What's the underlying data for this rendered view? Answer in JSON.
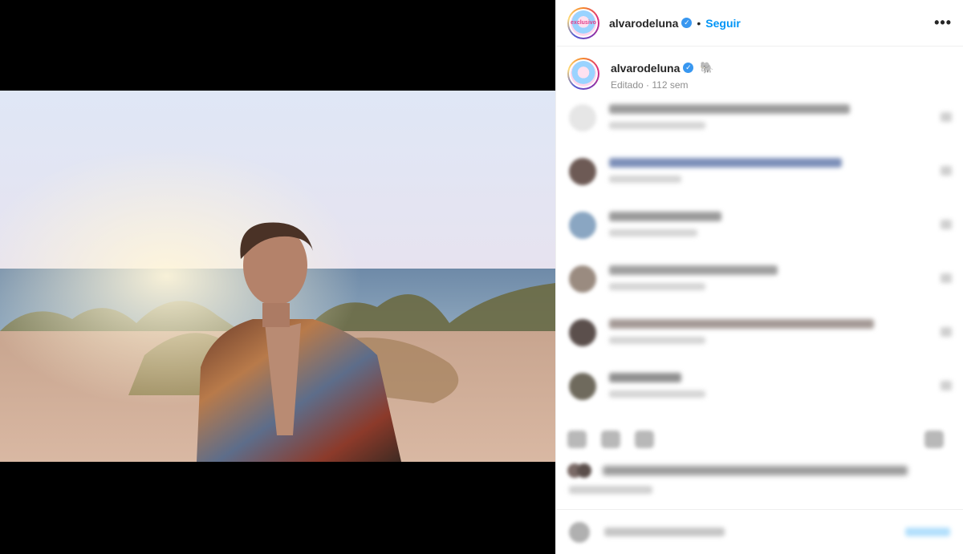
{
  "post": {
    "username": "alvarodeluna",
    "follow_label": "Seguir",
    "separator": "•",
    "more_label": "•••",
    "avatar_text": "exclusivo",
    "caption_emoji": "🐘",
    "edited_text": "Editado · 112 sem"
  },
  "comments": [
    {
      "avatar_color": "#e6e6e6",
      "line_width": 300,
      "line_color": "#9c9c9c",
      "sub_width": 120
    },
    {
      "avatar_color": "#6d5a55",
      "line_width": 290,
      "line_color": "#7c8fb8",
      "sub_width": 90
    },
    {
      "avatar_color": "#8aa6c2",
      "line_width": 140,
      "line_color": "#9a9a9a",
      "sub_width": 110
    },
    {
      "avatar_color": "#9a8b80",
      "line_width": 210,
      "line_color": "#a0a0a0",
      "sub_width": 120
    },
    {
      "avatar_color": "#5b4f4c",
      "line_width": 330,
      "line_color": "#a49a96",
      "sub_width": 120
    },
    {
      "avatar_color": "#6f6a5d",
      "line_width": 90,
      "line_color": "#8f8f8f",
      "sub_width": 120
    }
  ],
  "colors": {
    "accent": "#0095f6",
    "verified": "#3897f0",
    "text": "#262626",
    "muted": "#8e8e8e"
  },
  "icons": [
    "verified-badge-icon",
    "more-options-icon",
    "like-icon",
    "comment-icon",
    "share-icon",
    "save-icon",
    "emoji-icon"
  ]
}
